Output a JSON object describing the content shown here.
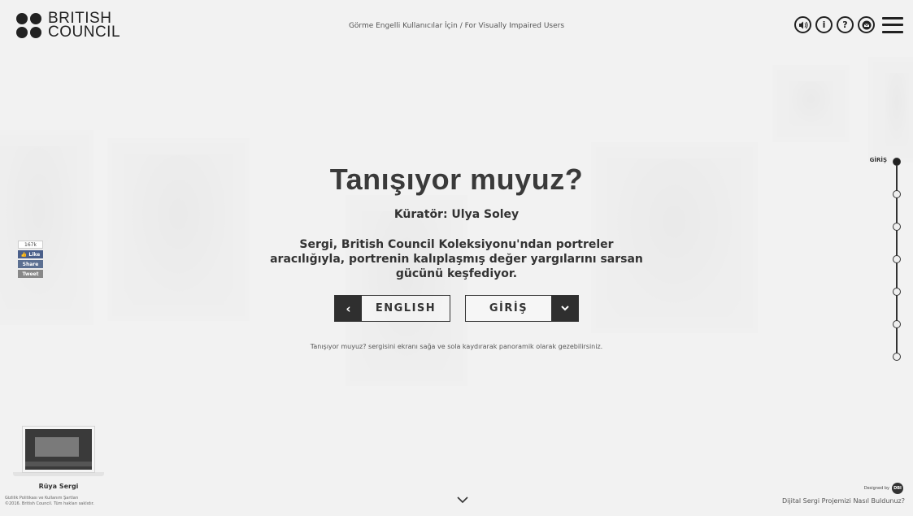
{
  "header": {
    "logo_line1": "BRITISH",
    "logo_line2": "COUNCIL",
    "accessibility_link": "Görme Engelli Kullanıcılar İçin  /  For Visually Impaired Users",
    "icons": [
      "sound-icon",
      "info-icon",
      "help-icon",
      "mail-icon",
      "menu-icon"
    ]
  },
  "main": {
    "title": "Tanışıyor muyuz?",
    "curator": "Küratör: Ulya Soley",
    "description": "Sergi, British Council Koleksiyonu'ndan portreler aracılığıyla, portrenin kalıplaşmış değer yargılarını sarsan gücünü keşfediyor.",
    "english_button": "ENGLISH",
    "giris_button": "GİRİŞ",
    "hint": "Tanışıyor muyuz? sergisini ekranı sağa ve sola kaydırarak panoramik olarak gezebilirsiniz."
  },
  "social": {
    "count": "167k",
    "like": "Like",
    "share": "Share",
    "tweet": "Tweet"
  },
  "timeline": {
    "active_label": "GİRİŞ",
    "node_count": 7
  },
  "bottom": {
    "thumbnail_label": "Rüya Sergi",
    "legal_line1": "Gizlilik Politikası ve Kullanım Şartları",
    "legal_line2": "©2016. British Council. Tüm hakları saklıdır.",
    "designed_by": "Designed by",
    "designer_logo": "DBI",
    "how_found": "Dijital Sergi Projemizi Nasıl Buldunuz?"
  },
  "colors": {
    "background": "#efefef",
    "dark": "#2f2f2f",
    "text": "#333333"
  }
}
